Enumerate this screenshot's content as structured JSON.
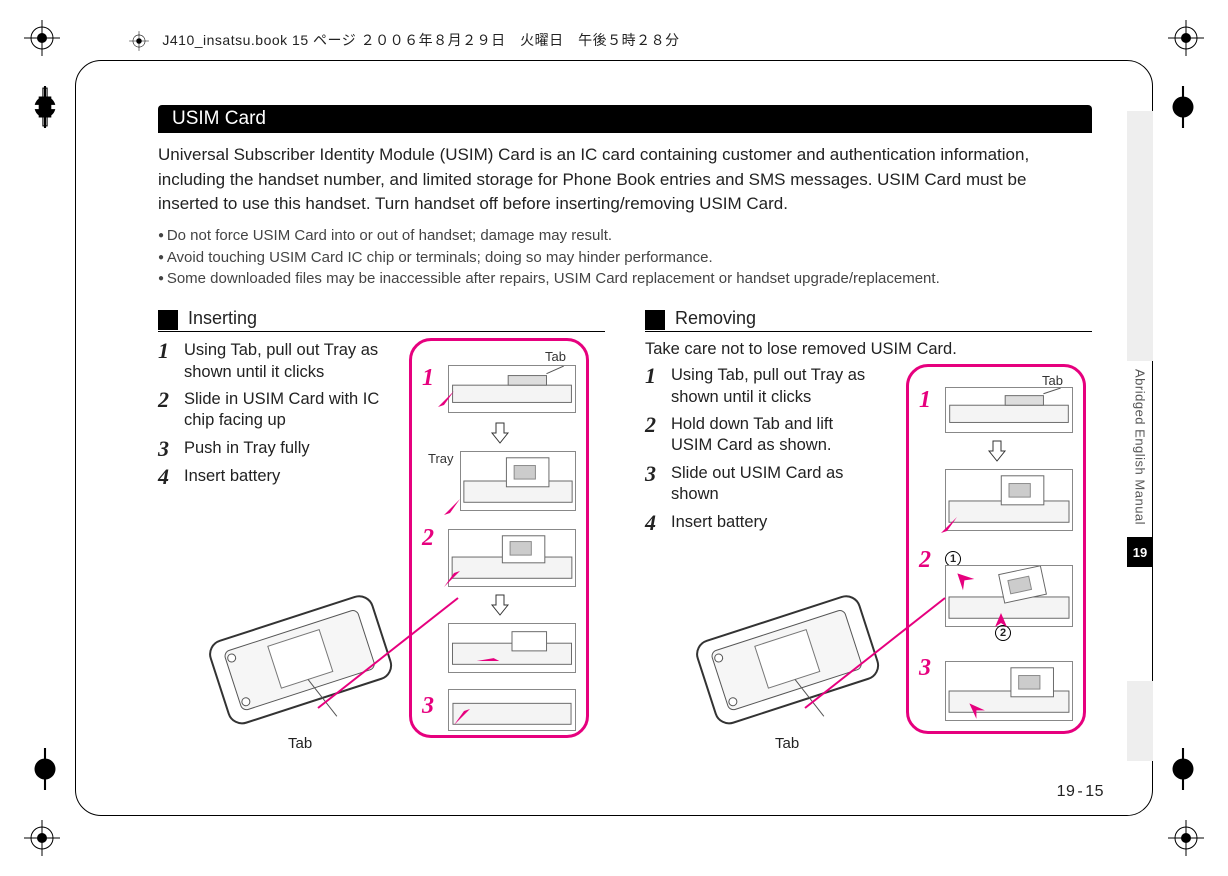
{
  "header": {
    "doc_info": "J410_insatsu.book 15 ページ ２００６年８月２９日　火曜日　午後５時２８分"
  },
  "sidebar": {
    "label": "Abridged English Manual",
    "chapter": "19"
  },
  "section_title": "USIM Card",
  "intro": "Universal Subscriber Identity Module (USIM) Card is an IC card containing customer and authentication information, including the handset number, and limited storage for Phone Book entries and SMS messages. USIM Card must be inserted to use this handset. Turn handset off before inserting/removing USIM Card.",
  "bullets": [
    "Do not force USIM Card into or out of handset; damage may result.",
    "Avoid touching USIM Card IC chip or terminals; doing so may hinder performance.",
    "Some downloaded files may be inaccessible after repairs, USIM Card replacement or handset upgrade/replacement."
  ],
  "columns": {
    "insert": {
      "heading": "Inserting",
      "steps": [
        "Using Tab, pull out Tray as shown until it clicks",
        "Slide in USIM Card with IC chip facing up",
        "Push in Tray fully",
        "Insert battery"
      ],
      "diagram": {
        "step_labels": [
          "1",
          "2",
          "3"
        ],
        "labels": {
          "tab": "Tab",
          "tray": "Tray"
        }
      },
      "phone_label": "Tab"
    },
    "remove": {
      "heading": "Removing",
      "note": "Take care not to lose removed USIM Card.",
      "steps": [
        "Using Tab, pull out Tray as shown until it clicks",
        "Hold down Tab and lift USIM Card as shown.",
        "Slide out USIM Card as shown",
        "Insert battery"
      ],
      "diagram": {
        "step_labels": [
          "1",
          "2",
          "3"
        ],
        "labels": {
          "tab": "Tab"
        },
        "sub_markers": [
          "1",
          "2"
        ]
      },
      "phone_label": "Tab"
    }
  },
  "page_number": {
    "chapter": "19",
    "page": "15"
  }
}
